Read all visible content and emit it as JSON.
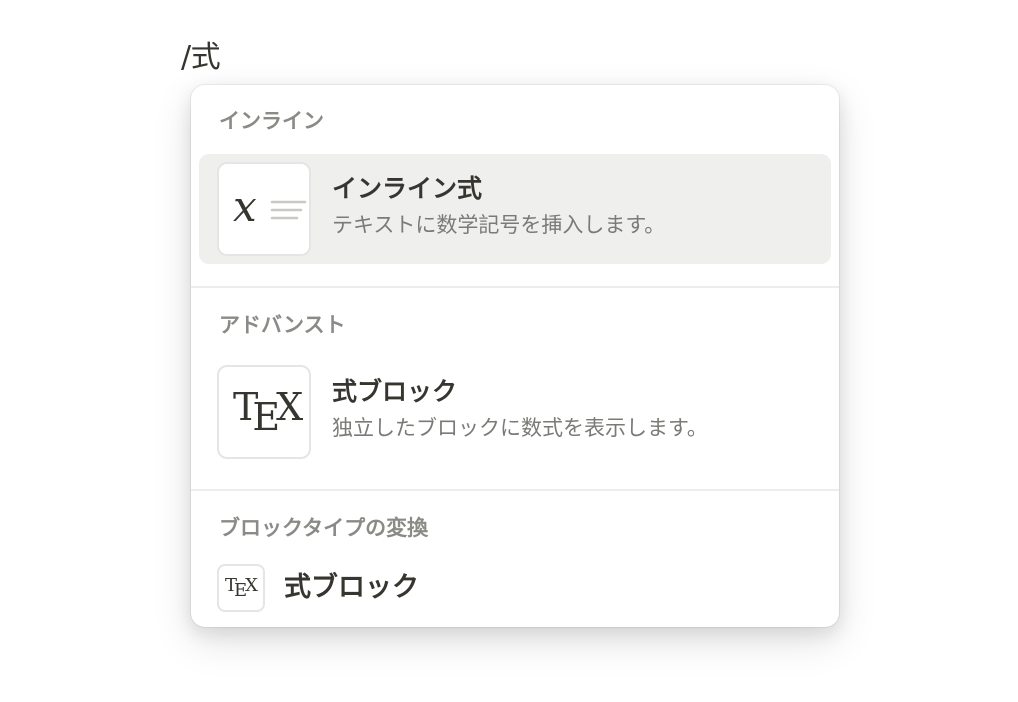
{
  "editor": {
    "command_text": "/式"
  },
  "menu": {
    "sections": [
      {
        "header": "インライン",
        "items": [
          {
            "title": "インライン式",
            "description": "テキストに数学記号を挿入します。",
            "icon": "inline-math-icon",
            "selected": true
          }
        ]
      },
      {
        "header": "アドバンスト",
        "items": [
          {
            "title": "式ブロック",
            "description": "独立したブロックに数式を表示します。",
            "icon": "tex-icon",
            "selected": false
          }
        ]
      },
      {
        "header": "ブロックタイプの変換",
        "items": [
          {
            "title": "式ブロック",
            "icon": "tex-icon",
            "selected": false
          }
        ]
      }
    ]
  },
  "colors": {
    "selected_background": "#efefee",
    "text_primary": "#37352f",
    "text_secondary": "#7a7a76",
    "section_header": "#8a8a86"
  }
}
